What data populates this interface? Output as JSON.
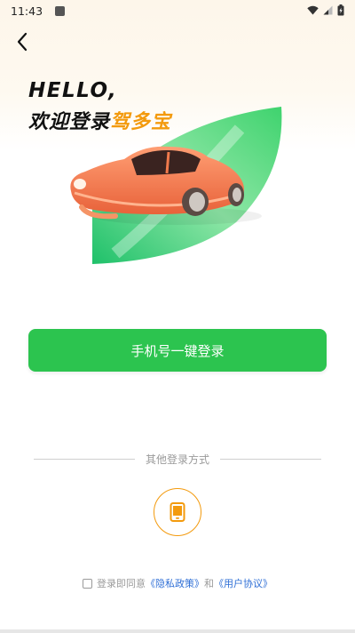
{
  "status_bar": {
    "time": "11:43"
  },
  "header": {
    "greeting": "HELLO,",
    "welcome_prefix": "欢迎登录",
    "brand_name": "驾多宝"
  },
  "actions": {
    "one_click_login": "手机号一键登录"
  },
  "other_login": {
    "label": "其他登录方式",
    "methods": [
      "phone-icon"
    ]
  },
  "agreement": {
    "prefix": "登录即同意",
    "privacy_link": "《隐私政策》",
    "conjunction": "和",
    "terms_link": "《用户协议》"
  },
  "colors": {
    "primary_green": "#2cc44f",
    "accent_orange": "#f39a0d",
    "link_blue": "#2f6fd6",
    "car_orange": "#f07a4c"
  }
}
